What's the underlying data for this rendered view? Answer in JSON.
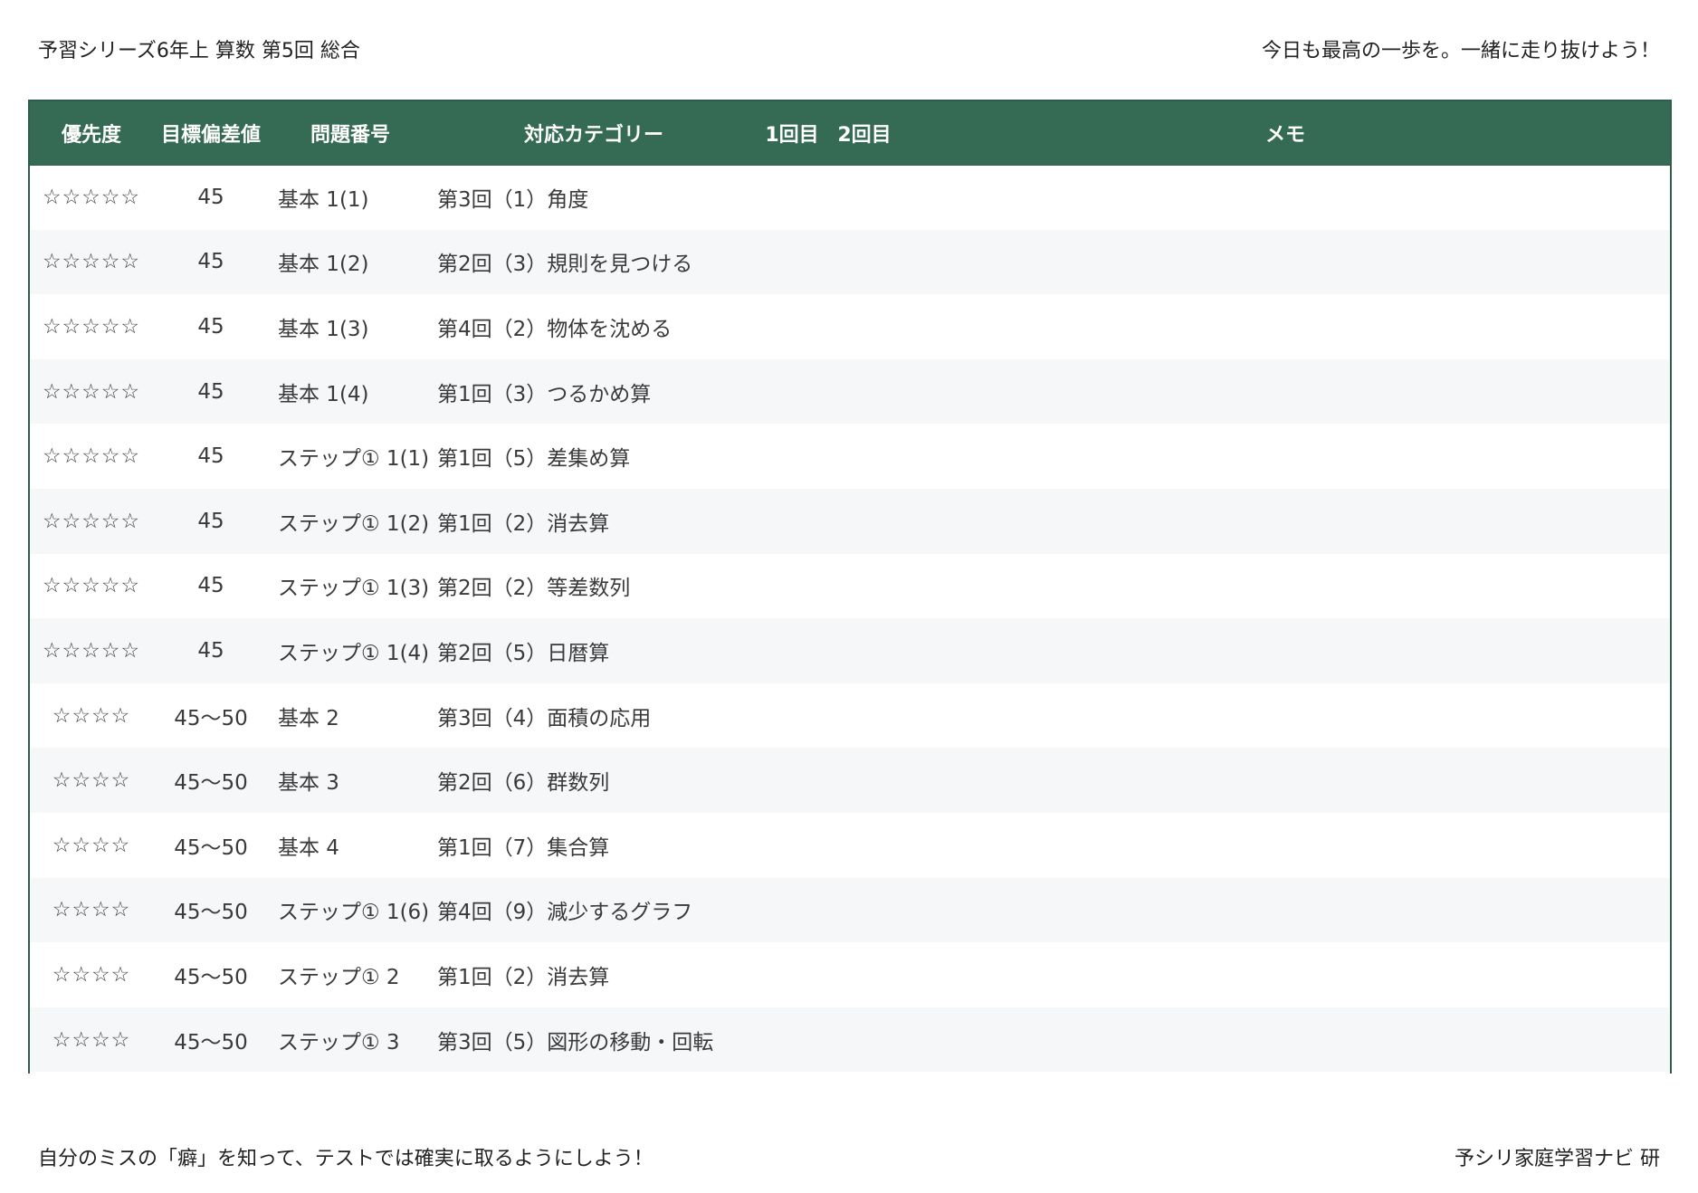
{
  "header": {
    "title": "予習シリーズ6年上 算数 第5回 総合",
    "motto": "今日も最高の一歩を。一緒に走り抜けよう！"
  },
  "table": {
    "columns": {
      "priority": "優先度",
      "target": "目標偏差値",
      "number": "問題番号",
      "category": "対応カテゴリー",
      "round1": "1回目",
      "round2": "2回目",
      "memo": "メモ"
    },
    "rows": [
      {
        "priority": "☆☆☆☆☆",
        "target": "45",
        "number": "基本 1(1)",
        "category": "第3回（1）角度"
      },
      {
        "priority": "☆☆☆☆☆",
        "target": "45",
        "number": "基本 1(2)",
        "category": "第2回（3）規則を見つける"
      },
      {
        "priority": "☆☆☆☆☆",
        "target": "45",
        "number": "基本 1(3)",
        "category": "第4回（2）物体を沈める"
      },
      {
        "priority": "☆☆☆☆☆",
        "target": "45",
        "number": "基本 1(4)",
        "category": "第1回（3）つるかめ算"
      },
      {
        "priority": "☆☆☆☆☆",
        "target": "45",
        "number": "ステップ① 1(1)",
        "category": "第1回（5）差集め算"
      },
      {
        "priority": "☆☆☆☆☆",
        "target": "45",
        "number": "ステップ① 1(2)",
        "category": "第1回（2）消去算"
      },
      {
        "priority": "☆☆☆☆☆",
        "target": "45",
        "number": "ステップ① 1(3)",
        "category": "第2回（2）等差数列"
      },
      {
        "priority": "☆☆☆☆☆",
        "target": "45",
        "number": "ステップ① 1(4)",
        "category": "第2回（5）日暦算"
      },
      {
        "priority": "☆☆☆☆",
        "target": "45〜50",
        "number": "基本 2",
        "category": "第3回（4）面積の応用"
      },
      {
        "priority": "☆☆☆☆",
        "target": "45〜50",
        "number": "基本 3",
        "category": "第2回（6）群数列"
      },
      {
        "priority": "☆☆☆☆",
        "target": "45〜50",
        "number": "基本 4",
        "category": "第1回（7）集合算"
      },
      {
        "priority": "☆☆☆☆",
        "target": "45〜50",
        "number": "ステップ① 1(6)",
        "category": "第4回（9）減少するグラフ"
      },
      {
        "priority": "☆☆☆☆",
        "target": "45〜50",
        "number": "ステップ① 2",
        "category": "第1回（2）消去算"
      },
      {
        "priority": "☆☆☆☆",
        "target": "45〜50",
        "number": "ステップ① 3",
        "category": "第3回（5）図形の移動・回転"
      }
    ]
  },
  "footer": {
    "message": "自分のミスの「癖」を知って、テストでは確実に取るようにしよう！",
    "credit": "予シリ家庭学習ナビ 研"
  }
}
